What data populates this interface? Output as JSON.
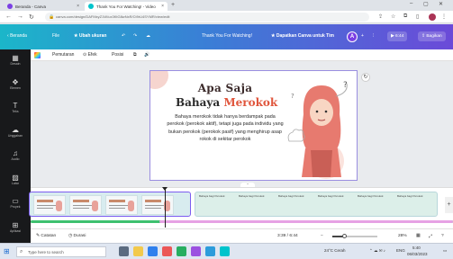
{
  "browser": {
    "tabs": [
      {
        "label": "Beranda - Canva",
        "color": "#7b3fe4"
      },
      {
        "label": "Thank You For Watching! - Video",
        "color": "#00c4cc"
      }
    ],
    "url": "canva.com/design/DAFMxyZ1W/ux3KtG8wNxR/Ct9rU4SYMR/view/edit",
    "window_controls": [
      "–",
      "▢",
      "✕"
    ]
  },
  "canva_bar": {
    "home": "Beranda",
    "file": "File",
    "resize": "Ubah ukuran",
    "doc_title": "Thank You For Watching!",
    "upgrade": "Dapatkan Canva untuk Tim",
    "avatar_letter": "A",
    "duration": "6:44",
    "share": "Bagikan"
  },
  "sidebar": {
    "items": [
      {
        "icon": "template-icon",
        "glyph": "▦",
        "label": "Desain"
      },
      {
        "icon": "elements-icon",
        "glyph": "✥",
        "label": "Elemen"
      },
      {
        "icon": "text-icon",
        "glyph": "T",
        "label": "Teks"
      },
      {
        "icon": "upload-icon",
        "glyph": "☁",
        "label": "Unggahan"
      },
      {
        "icon": "audio-icon",
        "glyph": "♫",
        "label": "Audio"
      },
      {
        "icon": "background-icon",
        "glyph": "▨",
        "label": "Latar"
      },
      {
        "icon": "folder-icon",
        "glyph": "▭",
        "label": "Proyek"
      },
      {
        "icon": "apps-icon",
        "glyph": "⊞",
        "label": "Aplikasi"
      }
    ]
  },
  "toolbar": {
    "animate": "Pemutaran",
    "edit": "Efek",
    "position": "Posisi"
  },
  "slide": {
    "title_line1": "Apa Saja",
    "title_line2_a": "Bahaya ",
    "title_line2_b": "Merokok",
    "body": "Bahaya merokok tidak hanya berdampak pada perokok (perokok aktif), tetapi juga pada individu yang bukan perokok (perokok pasif) yang menghirup asap rokok di sekitar perokok"
  },
  "timeline": {
    "clip_titles": [
      "Bahaya bagi Perokok",
      "Bahaya bagi Perokok",
      "Bahaya bagi Perokok",
      "Bahaya bagi Perokok",
      "Bahaya bagi Perokok",
      "Bahaya bagi Perokok"
    ]
  },
  "footer": {
    "notes": "Catatan",
    "duration_btn": "Durasi",
    "time": "3:39 / 6:44",
    "zoom": "28%",
    "zoom_fraction": 0.28
  },
  "taskbar": {
    "search_placeholder": "Type here to search",
    "weather": "24°C  Cerah",
    "time": "5:40",
    "date": "06/03/2023",
    "lang": "ENG"
  },
  "colors": {
    "accent": "#7c5cf0",
    "highlight": "#e0563d",
    "cyan": "#1bb6c9"
  }
}
